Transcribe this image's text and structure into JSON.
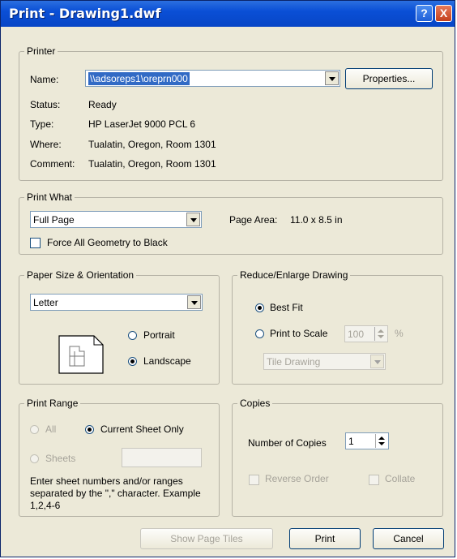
{
  "window": {
    "title": "Print - Drawing1.dwf",
    "help_label": "?",
    "close_label": "X"
  },
  "printer": {
    "legend": "Printer",
    "name_label": "Name:",
    "name_value": "\\\\adsoreps1\\oreprn000",
    "properties_label": "Properties...",
    "status_label": "Status:",
    "status_value": "Ready",
    "type_label": "Type:",
    "type_value": "HP LaserJet 9000 PCL 6",
    "where_label": "Where:",
    "where_value": "Tualatin, Oregon, Room 1301",
    "comment_label": "Comment:",
    "comment_value": "Tualatin, Oregon, Room 1301"
  },
  "print_what": {
    "legend": "Print What",
    "selected": "Full Page",
    "page_area_label": "Page Area:",
    "page_area_value": "11.0 x 8.5 in",
    "force_black_label": "Force All Geometry to Black"
  },
  "paper": {
    "legend": "Paper Size & Orientation",
    "size": "Letter",
    "portrait_label": "Portrait",
    "landscape_label": "Landscape"
  },
  "reduce": {
    "legend": "Reduce/Enlarge Drawing",
    "best_fit_label": "Best Fit",
    "scale_label": "Print to Scale",
    "scale_value": "100",
    "percent": "%",
    "tile_label": "Tile Drawing"
  },
  "range": {
    "legend": "Print Range",
    "all_label": "All",
    "current_label": "Current Sheet Only",
    "sheets_label": "Sheets",
    "hint": "Enter sheet numbers and/or ranges separated by the \",\" character. Example 1,2,4-6"
  },
  "copies": {
    "legend": "Copies",
    "number_label": "Number of Copies",
    "number_value": "1",
    "reverse_label": "Reverse Order",
    "collate_label": "Collate"
  },
  "buttons": {
    "show_tiles": "Show Page Tiles",
    "print": "Print",
    "cancel": "Cancel"
  }
}
